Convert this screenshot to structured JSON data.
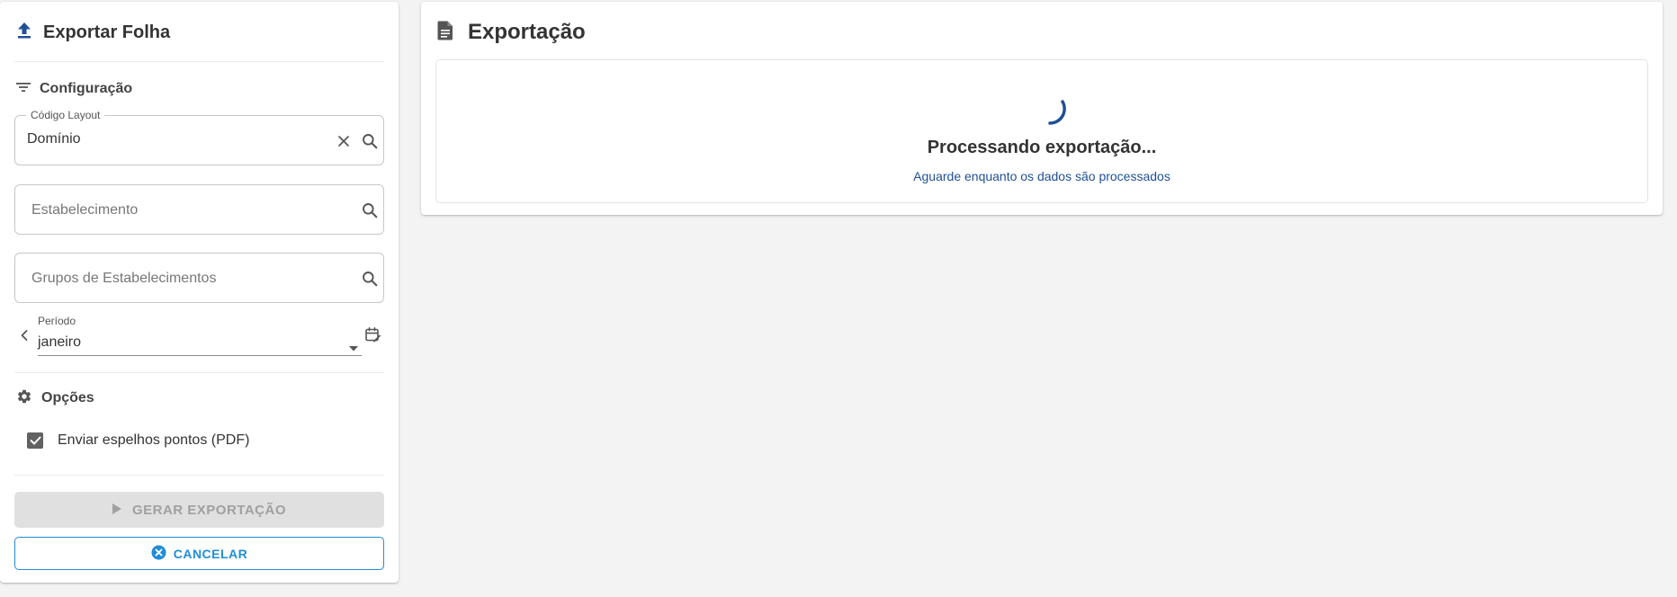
{
  "left_panel": {
    "title": "Exportar Folha",
    "config_section": {
      "title": "Configuração"
    },
    "fields": {
      "layout_code": {
        "label": "Código Layout",
        "value": "Domínio"
      },
      "establishment": {
        "placeholder": "Estabelecimento"
      },
      "establishment_groups": {
        "placeholder": "Grupos de Estabelecimentos"
      }
    },
    "period": {
      "label": "Período",
      "value": "janeiro"
    },
    "options_section": {
      "title": "Opções",
      "send_pdf": {
        "label": "Enviar espelhos pontos (PDF)",
        "checked": true
      }
    },
    "actions": {
      "generate_label": "GERAR EXPORTAÇÃO",
      "cancel_label": "CANCELAR"
    }
  },
  "right_panel": {
    "title": "Exportação",
    "status": {
      "title": "Processando exportação...",
      "subtitle": "Aguarde enquanto os dados são processados"
    }
  },
  "colors": {
    "accent_blue": "#1f4f96",
    "cancel_blue": "#1f8dd6",
    "disabled_bg": "#e0e0e0",
    "checkbox_gray": "#616161",
    "background": "#f3f3f3"
  },
  "icons": {
    "export": "upload-icon",
    "filter": "filter-icon",
    "clear": "close-icon",
    "search": "search-icon",
    "prev": "chevron-left-icon",
    "dropdown": "arrow-drop-down-icon",
    "calendar": "calendar-edit-icon",
    "settings": "gear-icon",
    "play": "play-icon",
    "cancel": "cancel-circle-icon",
    "document": "document-icon"
  }
}
